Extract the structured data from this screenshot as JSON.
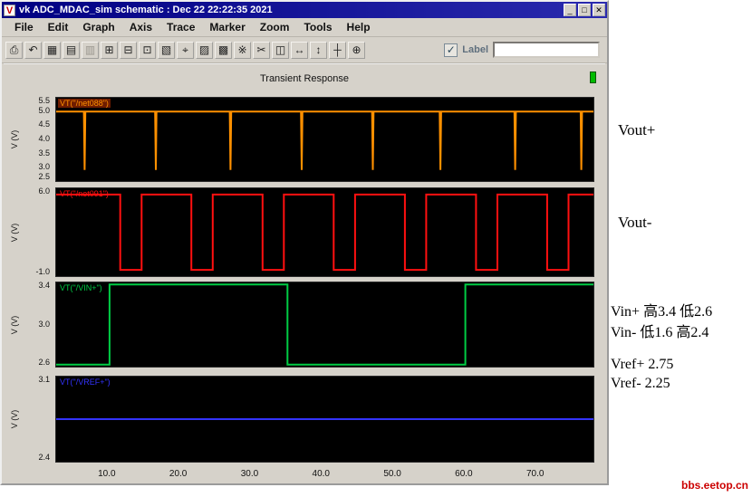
{
  "window": {
    "title": "vk ADC_MDAC_sim schematic : Dec 22 22:22:35 2021",
    "icon_letter": "V",
    "controls": {
      "minimize": "_",
      "maximize": "□",
      "close": "✕"
    }
  },
  "menu": {
    "items": [
      "File",
      "Edit",
      "Graph",
      "Axis",
      "Trace",
      "Marker",
      "Zoom",
      "Tools",
      "Help"
    ]
  },
  "toolbar": {
    "icons": [
      {
        "name": "print",
        "glyph": "⎙"
      },
      {
        "name": "undo",
        "glyph": "↶"
      },
      {
        "name": "table",
        "glyph": "▦"
      },
      {
        "name": "strip-chart",
        "glyph": "▤"
      },
      {
        "name": "composite-mode",
        "glyph": "▥",
        "disabled": true
      },
      {
        "name": "new-subwindow",
        "glyph": "⊞"
      },
      {
        "name": "copy",
        "glyph": "⊟"
      },
      {
        "name": "paste",
        "glyph": "⊡"
      },
      {
        "name": "snapshot",
        "glyph": "▧"
      },
      {
        "name": "marker",
        "glyph": "⌖"
      },
      {
        "name": "vert-marker",
        "glyph": "▨"
      },
      {
        "name": "grid",
        "glyph": "▩"
      },
      {
        "name": "reference",
        "glyph": "※"
      },
      {
        "name": "cut",
        "glyph": "✂"
      },
      {
        "name": "zoom-box",
        "glyph": "◫"
      },
      {
        "name": "zoom-x",
        "glyph": "↔"
      },
      {
        "name": "zoom-y",
        "glyph": "↕"
      },
      {
        "name": "zoom-fit",
        "glyph": "┼"
      },
      {
        "name": "pan",
        "glyph": "⊕"
      }
    ],
    "label_checkbox": {
      "label": "Label",
      "checked": true,
      "check_glyph": "✓"
    },
    "label_input": {
      "value": "",
      "placeholder": ""
    }
  },
  "header": {
    "title": "Transient Response"
  },
  "chart_data": [
    {
      "type": "line",
      "name": "VT(\"/net088\")",
      "color": "#ff9000",
      "ylabel": "V (V)",
      "xlim": [
        2.5,
        78
      ],
      "ylim": [
        2.5,
        5.5
      ],
      "yticks": [
        "5.5",
        "5.0",
        "4.5",
        "4.0",
        "3.5",
        "3.0",
        "2.5"
      ],
      "xticks": [
        "10.0",
        "20.0",
        "30.0",
        "40.0",
        "50.0",
        "60.0",
        "70.0"
      ],
      "x": [
        2.5,
        6.4,
        6.5,
        6.6,
        16.4,
        16.5,
        16.6,
        26.9,
        27,
        27.1,
        36.9,
        37,
        37.1,
        46.9,
        47,
        47.1,
        56.4,
        56.5,
        56.6,
        66.9,
        67,
        67.1,
        76.2,
        76.3,
        76.4,
        78
      ],
      "y": [
        5.0,
        5.0,
        2.9,
        5.0,
        5.0,
        2.9,
        5.0,
        5.0,
        2.9,
        5.0,
        5.0,
        2.9,
        5.0,
        5.0,
        2.9,
        5.0,
        5.0,
        2.9,
        5.0,
        5.0,
        2.9,
        5.0,
        5.0,
        2.9,
        5.0,
        5.0
      ]
    },
    {
      "type": "line",
      "name": "VT(\"/net091\")",
      "color": "#ff1010",
      "ylabel": "V (V)",
      "xlim": [
        2.5,
        78
      ],
      "ylim": [
        -1.0,
        6.0
      ],
      "yticks": [
        "6.0",
        "-1.0"
      ],
      "x": [
        2.5,
        11.5,
        11.5,
        14.5,
        14.5,
        21.5,
        21.5,
        24.5,
        24.5,
        31.5,
        31.5,
        34.5,
        34.5,
        41.5,
        41.5,
        44.5,
        44.5,
        51.5,
        51.5,
        54.5,
        54.5,
        61.5,
        61.5,
        64.5,
        64.5,
        71.5,
        71.5,
        74.5,
        74.5,
        78
      ],
      "y": [
        5.5,
        5.5,
        -0.5,
        -0.5,
        5.5,
        5.5,
        -0.5,
        -0.5,
        5.5,
        5.5,
        -0.5,
        -0.5,
        5.5,
        5.5,
        -0.5,
        -0.5,
        5.5,
        5.5,
        -0.5,
        -0.5,
        5.5,
        5.5,
        -0.5,
        -0.5,
        5.5,
        5.5,
        -0.5,
        -0.5,
        5.5,
        5.5
      ]
    },
    {
      "type": "line",
      "name": "VT(\"/VIN+\")",
      "color": "#00cc44",
      "ylabel": "V (V)",
      "xlim": [
        2.5,
        78
      ],
      "ylim": [
        2.6,
        3.4
      ],
      "yticks": [
        "3.4",
        "3.0",
        "2.6"
      ],
      "x": [
        2.5,
        10,
        10,
        35,
        35,
        60,
        60,
        78
      ],
      "y": [
        2.62,
        2.62,
        3.38,
        3.38,
        2.62,
        2.62,
        3.38,
        3.38
      ]
    },
    {
      "type": "line",
      "name": "VT(\"/VREF+\")",
      "color": "#3333ff",
      "ylabel": "V (V)",
      "xlim": [
        2.5,
        78
      ],
      "ylim": [
        2.4,
        3.1
      ],
      "yticks": [
        "3.1",
        "2.4"
      ],
      "x": [
        2.5,
        78
      ],
      "y": [
        2.75,
        2.75
      ]
    }
  ],
  "annotations": {
    "vout_plus": "Vout+",
    "vout_minus": "Vout-",
    "vin_plus": "Vin+ 高3.4  低2.6",
    "vin_minus": "Vin-  低1.6  高2.4",
    "vref_plus": "Vref+  2.75",
    "vref_minus": "Vref-   2.25",
    "watermark": "bbs.eetop.cn"
  }
}
